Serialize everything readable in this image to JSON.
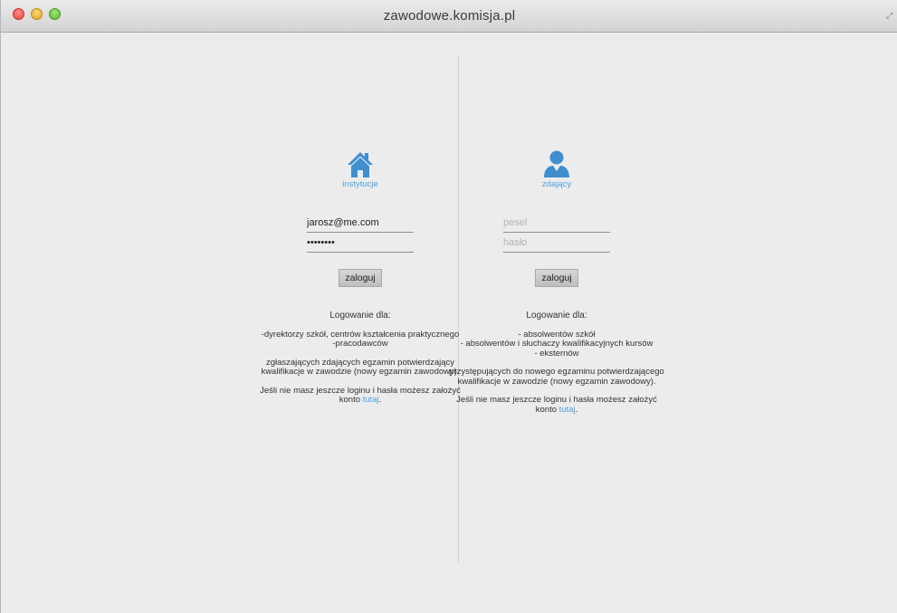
{
  "window": {
    "title": "zawodowe.komisja.pl"
  },
  "left_panel": {
    "label": "instytucje",
    "icon": "house-icon",
    "email_value": "jarosz@me.com",
    "password_value": "••••••••",
    "login_button": "zaloguj",
    "heading": "Logowanie dla:",
    "audience": [
      "-dyrektorzy szkół, centrów kształcenia praktycznego",
      "-pracodawców"
    ],
    "description": "zgłaszających zdających egzamin potwierdzający kwalifikacje w zawodzie (nowy egzamin zawodowy).",
    "signup_text": "Jeśli nie masz jeszcze loginu i hasła możesz założyć konto ",
    "signup_link": "tutaj",
    "signup_end": "."
  },
  "right_panel": {
    "label": "zdający",
    "icon": "user-icon",
    "pesel_placeholder": "pesel",
    "password_placeholder": "hasło",
    "login_button": "zaloguj",
    "heading": "Logowanie dla:",
    "audience": [
      "- absolwentów szkół",
      "- absolwentów i słuchaczy kwalifikacyjnych kursów",
      "- eksternów"
    ],
    "description": "przystępujących do nowego egzaminu potwierdzającego kwalifikacje w zawodzie (nowy egzamin zawodowy).",
    "signup_text": "Jeśli nie masz jeszcze loginu i hasła możesz założyć konto ",
    "signup_link": "tutaj",
    "signup_end": "."
  },
  "colors": {
    "accent": "#4aa3df",
    "background": "#ececec"
  }
}
